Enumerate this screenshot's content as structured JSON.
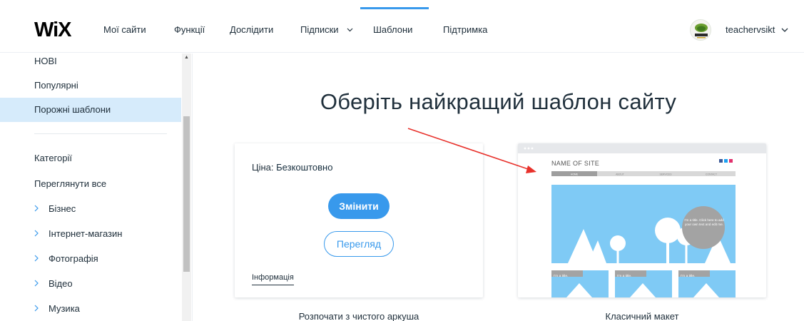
{
  "header": {
    "logo": "WiX",
    "nav": [
      {
        "label": "Мої сайти",
        "dropdown": false
      },
      {
        "label": "Функції",
        "dropdown": false
      },
      {
        "label": "Дослідити",
        "dropdown": false
      },
      {
        "label": "Підписки",
        "dropdown": true
      },
      {
        "label": "Шаблони",
        "dropdown": false,
        "active": true
      },
      {
        "label": "Підтримка",
        "dropdown": false
      }
    ],
    "user": "teachervsikt",
    "user_chevron": "⌵"
  },
  "sidebar": {
    "items": [
      {
        "label": "НОВІ"
      },
      {
        "label": "Популярні"
      },
      {
        "label": "Порожні шаблони",
        "selected": true
      },
      {
        "label": "Категорії"
      },
      {
        "label": "Переглянути все"
      },
      {
        "label": "Бізнес",
        "expandable": true
      },
      {
        "label": "Інтернет-магазин",
        "expandable": true
      },
      {
        "label": "Фотографія",
        "expandable": true
      },
      {
        "label": "Відео",
        "expandable": true
      },
      {
        "label": "Музика",
        "expandable": true
      }
    ]
  },
  "main": {
    "heading": "Оберіть найкращий шаблон сайту",
    "blank_card": {
      "price_label": "Ціна: ",
      "price_value": "Безкоштовно",
      "edit_button": "Змінити",
      "view_button": "Перегляд",
      "info_link": "Інформація",
      "caption": "Розпочати з чистого аркуша"
    },
    "classic_card": {
      "caption": "Класичний макет",
      "mock": {
        "site_name": "NAME OF SITE",
        "menu": [
          "HOME",
          "ABOUT",
          "SERVICES",
          "CONTACT"
        ],
        "bubble_text": "I'm a title. Click here to add your own text and edit me.",
        "tile_title": "I'm a title."
      }
    }
  },
  "colors": {
    "accent": "#3899ec",
    "selected_bg": "#d6ebfb",
    "annotation_arrow": "#e8312b"
  }
}
